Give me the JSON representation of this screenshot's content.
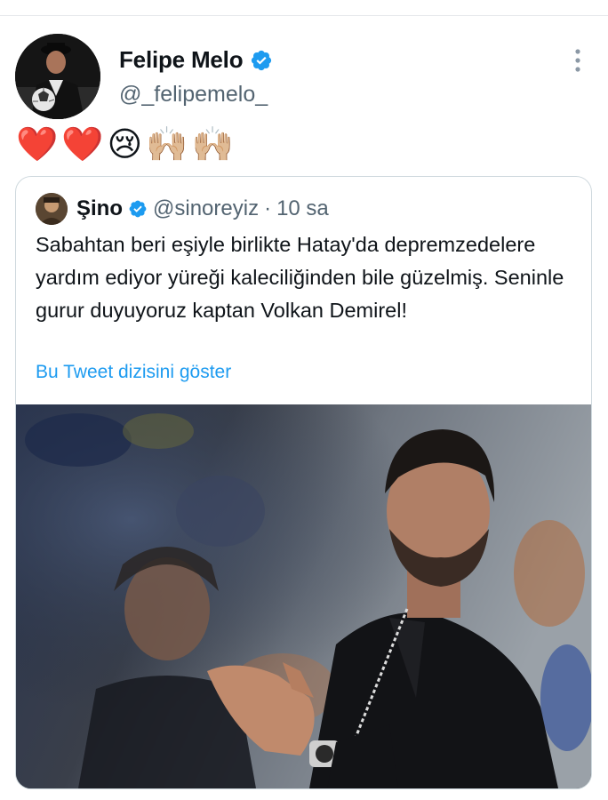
{
  "author": {
    "name": "Felipe Melo",
    "handle": "@_felipemelo_"
  },
  "emojis": [
    "❤️",
    "❤️",
    "😢",
    "🙌🏼",
    "🙌🏼"
  ],
  "quoted": {
    "name": "Şino",
    "handle": "@sinoreyiz",
    "separator": "·",
    "time": "10 sa",
    "text": "Sabahtan beri eşiyle birlikte Hatay'da depremzedelere yardım ediyor yüreği kaleciliğinden bile güzelmiş. Seninle gurur duyuyoruz kaptan Volkan Demirel!",
    "thread_link": "Bu Tweet dizisini göster"
  },
  "colors": {
    "verified": "#1d9bf0",
    "link": "#1d9bf0",
    "secondary_text": "#536471",
    "border": "#cfd9de"
  },
  "icons": {
    "verified": "verified-badge-icon",
    "more": "more-vertical-icon"
  }
}
